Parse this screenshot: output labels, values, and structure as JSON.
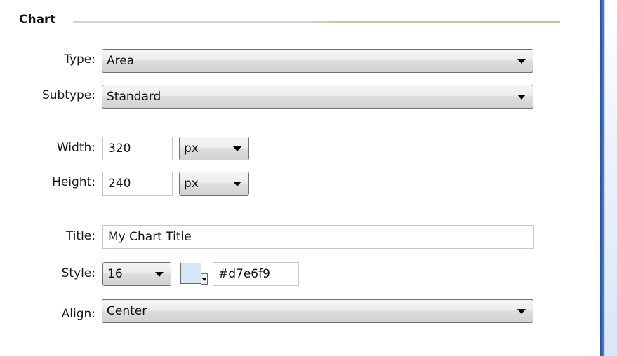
{
  "section": {
    "title": "Chart"
  },
  "fields": {
    "type": {
      "label": "Type:",
      "value": "Area"
    },
    "subtype": {
      "label": "Subtype:",
      "value": "Standard"
    },
    "width": {
      "label": "Width:",
      "value": "320",
      "unit": "px"
    },
    "height": {
      "label": "Height:",
      "value": "240",
      "unit": "px"
    },
    "title": {
      "label": "Title:",
      "value": "My Chart Title"
    },
    "style": {
      "label": "Style:",
      "font_size": "16",
      "color_swatch": "#d7e6f9",
      "color_hex": "#d7e6f9"
    },
    "align": {
      "label": "Align:",
      "value": "Center"
    }
  },
  "icons": {
    "dropdown": "chevron-down-icon",
    "color_picker": "color-swatch-icon"
  },
  "colors": {
    "section_rule_accent": "#c8c094",
    "side_bar": "#2f5fb3"
  }
}
